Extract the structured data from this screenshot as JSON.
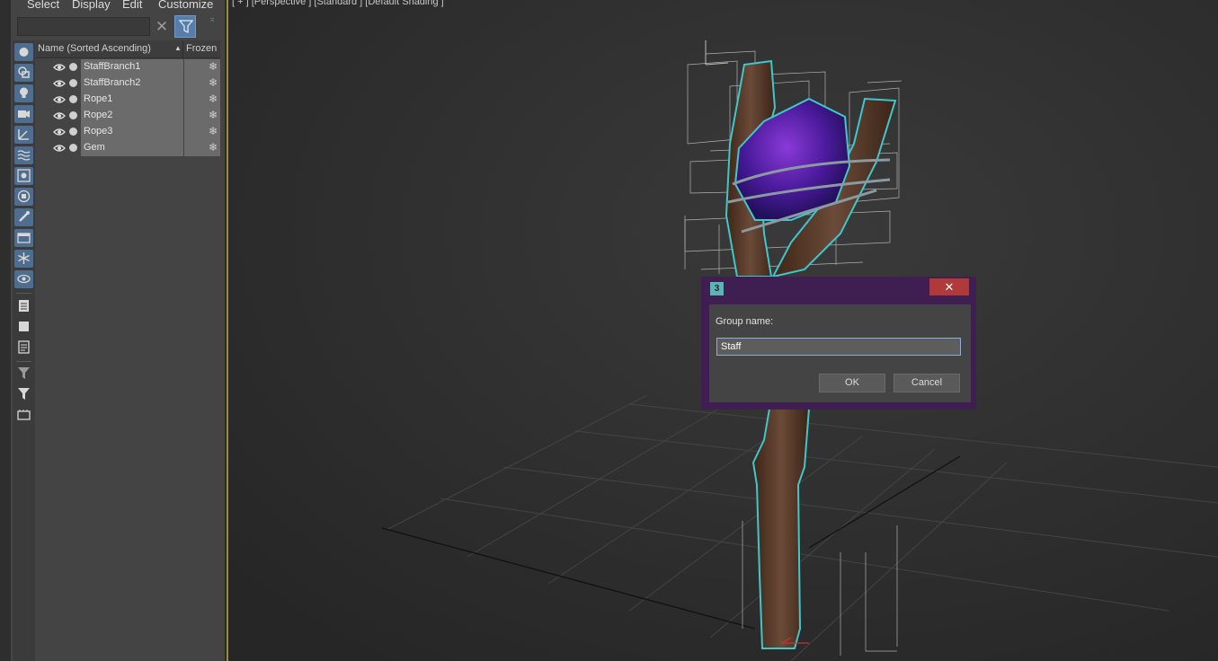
{
  "menu": [
    "Select",
    "Display",
    "Edit",
    "Customize"
  ],
  "explorer": {
    "clear_glyph": "✕",
    "pin_glyph": "⌅",
    "columns": {
      "name": "Name (Sorted Ascending)",
      "sort_arrow": "▲",
      "frozen": "Frozen"
    },
    "items": [
      {
        "name": "StaffBranch1",
        "frozen_glyph": "❄"
      },
      {
        "name": "StaffBranch2",
        "frozen_glyph": "❄"
      },
      {
        "name": "Rope1",
        "frozen_glyph": "❄"
      },
      {
        "name": "Rope2",
        "frozen_glyph": "❄"
      },
      {
        "name": "Rope3",
        "frozen_glyph": "❄"
      },
      {
        "name": "Gem",
        "frozen_glyph": "❄"
      }
    ],
    "toolbar_icons": [
      "geometry-icon",
      "shape-icon",
      "light-icon",
      "camera-icon",
      "helper-icon",
      "spacewarp-icon",
      "group-icon",
      "xref-icon",
      "bone-icon",
      "container-icon",
      "frozen-icon",
      "hidden-icon",
      "layer-icon",
      "stop-icon",
      "properties-icon",
      "filter-icon",
      "filter-funnel-icon",
      "selection-set-icon"
    ]
  },
  "viewport": {
    "label": "[ + ] [Perspective ] [Standard ] [Default Shading ]"
  },
  "dialog": {
    "icon_text": "3",
    "close_glyph": "✕",
    "field_label": "Group name:",
    "field_value": "Staff",
    "ok_label": "OK",
    "cancel_label": "Cancel"
  },
  "colors": {
    "selection_outline": "#3fc8cc",
    "gem": "#4a1a8a",
    "wood": "#5a3b2a",
    "dialog_frame": "#3f1f52",
    "close_button": "#b03a3a"
  }
}
